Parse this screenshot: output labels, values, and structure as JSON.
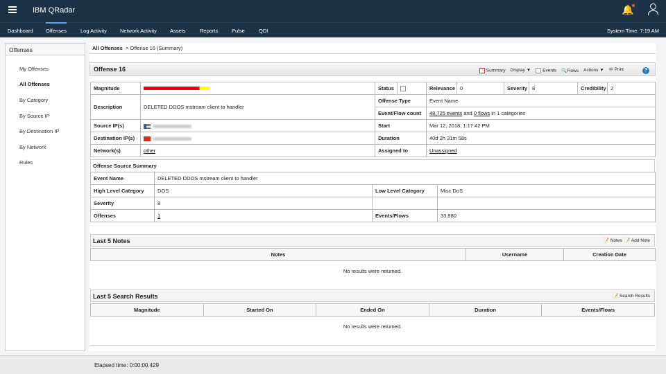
{
  "app": {
    "title": "IBM QRadar",
    "system_time": "System Time: 7:19 AM"
  },
  "nav": [
    "Dashboard",
    "Offenses",
    "Log Activity",
    "Network Activity",
    "Assets",
    "Reports",
    "Pulse",
    "QDI"
  ],
  "sidebar": {
    "title": "Offenses",
    "items": [
      "My Offenses",
      "All Offenses",
      "By Category",
      "By Source IP",
      "By Destination IP",
      "By Network",
      "Rules"
    ]
  },
  "breadcrumb": {
    "root": "All Offenses",
    "current": "> Offense 16 (Summary)"
  },
  "offense": {
    "title": "Offense 16",
    "toolbar": {
      "summary": "Summary",
      "display": "Display ▼",
      "events": "Events",
      "flows": "Flows",
      "actions": "Actions ▼",
      "print": "Print"
    },
    "magnitude_label": "Magnitude",
    "magnitude_level": 0.85,
    "description_label": "Description",
    "description": "DELETED DDOS mstream client to handler",
    "source_label": "Source IP(s)",
    "destination_label": "Destination IP(s)",
    "network_label": "Network(s)",
    "network": "other",
    "status_label": "Status",
    "relevance_label": "Relevance",
    "relevance": "0",
    "severity_label": "Severity",
    "severity": "8",
    "credibility_label": "Credibility",
    "credibility": "2",
    "offense_type_label": "Offense Type",
    "offense_type": "Event Name",
    "count_label": "Event/Flow count",
    "events_link": "48,725 events",
    "and": "and",
    "flows_link": "0 flows",
    "categories": "in 1 categories",
    "start_label": "Start",
    "start": "Mar 12, 2018, 1:17:42 PM",
    "duration_label": "Duration",
    "duration": "40d 2h 31m 58s",
    "assigned_label": "Assigned to",
    "assigned": "Unassigned"
  },
  "source_summary": {
    "title": "Offense Source Summary",
    "event_name_label": "Event Name",
    "event_name": "DELETED DDOS mstream client to handler",
    "hlc_label": "High Level Category",
    "hlc": "DOS",
    "llc_label": "Low Level Category",
    "llc": "Misc DoS",
    "severity_label": "Severity",
    "severity": "8",
    "offenses_label": "Offenses",
    "offenses": "1",
    "ef_label": "Events/Flows",
    "ef": "33,980"
  },
  "notes": {
    "title": "Last 5 Notes",
    "notes_btn": "Notes",
    "add_btn": "Add Note",
    "columns": [
      "Notes",
      "Username",
      "Creation Date"
    ],
    "empty": "No results were returned."
  },
  "search": {
    "title": "Last 5 Search Results",
    "btn": "Search Results",
    "columns": [
      "Magnitude",
      "Started On",
      "Ended On",
      "Duration",
      "Events/Flows"
    ],
    "empty": "No results were returned."
  },
  "footer": {
    "elapsed": "Elapsed time: 0:00:00.429"
  }
}
